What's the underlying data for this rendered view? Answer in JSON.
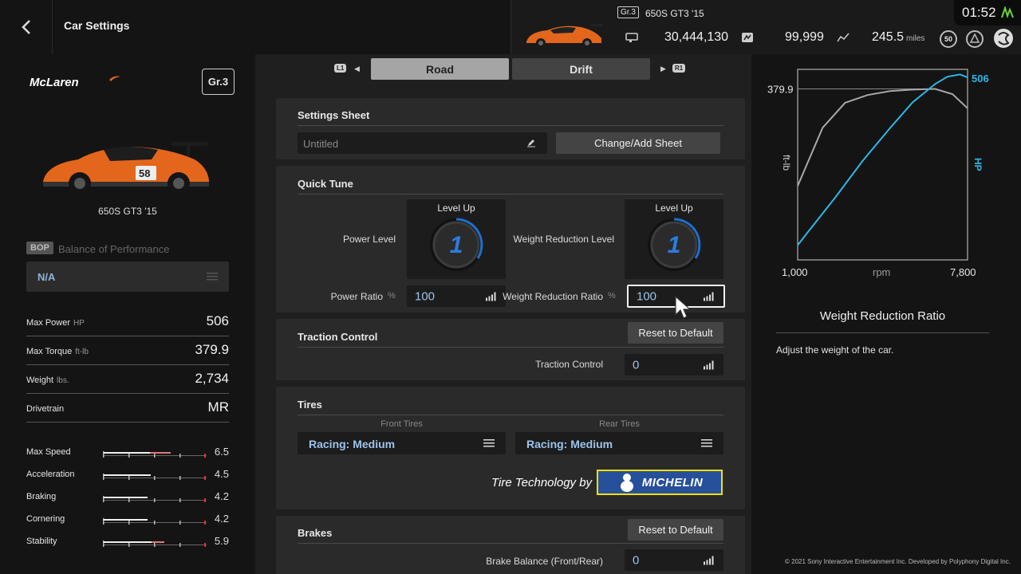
{
  "header": {
    "page_title": "Car Settings",
    "car_class": "Gr.3",
    "car_name": "650S GT3 '15",
    "credits": "30,444,130",
    "mileage_points": "99,999",
    "distance": "245.5",
    "distance_unit": "miles",
    "level": "50",
    "clock": "01:52"
  },
  "left": {
    "brand": "McLaren",
    "class_badge": "Gr.3",
    "car_name": "650S GT3 '15",
    "bop_badge": "BOP",
    "bop_label": "Balance of Performance",
    "bop_value": "N/A",
    "specs": [
      {
        "label": "Max Power",
        "unit": "HP",
        "value": "506"
      },
      {
        "label": "Max Torque",
        "unit": "ft-lb",
        "value": "379.9"
      },
      {
        "label": "Weight",
        "unit": "lbs.",
        "value": "2,734"
      },
      {
        "label": "Drivetrain",
        "unit": "",
        "value": "MR"
      }
    ],
    "performance": [
      {
        "label": "Max Speed",
        "value": "6.5",
        "fill": 0.65,
        "accent": 0.2
      },
      {
        "label": "Acceleration",
        "value": "4.5",
        "fill": 0.45,
        "accent": 0.0
      },
      {
        "label": "Braking",
        "value": "4.2",
        "fill": 0.42,
        "accent": 0.0
      },
      {
        "label": "Cornering",
        "value": "4.2",
        "fill": 0.42,
        "accent": 0.0
      },
      {
        "label": "Stability",
        "value": "5.9",
        "fill": 0.59,
        "accent": 0.12
      }
    ]
  },
  "tabs": {
    "left_button": "L1",
    "road": "Road",
    "drift": "Drift",
    "right_button": "R1"
  },
  "settings_sheet": {
    "title": "Settings Sheet",
    "sheet_name": "Untitled",
    "change_button": "Change/Add Sheet"
  },
  "quick_tune": {
    "title": "Quick Tune",
    "power_level_label": "Power Level",
    "power_level_title": "Level Up",
    "power_level_value": "1",
    "weight_level_label": "Weight Reduction Level",
    "weight_level_title": "Level Up",
    "weight_level_value": "1",
    "power_ratio_label": "Power Ratio",
    "power_ratio_unit": "%",
    "power_ratio_value": "100",
    "weight_ratio_label": "Weight Reduction Ratio",
    "weight_ratio_unit": "%",
    "weight_ratio_value": "100"
  },
  "traction": {
    "title": "Traction Control",
    "reset_button": "Reset to Default",
    "label": "Traction Control",
    "value": "0"
  },
  "tires": {
    "title": "Tires",
    "front_label": "Front Tires",
    "front_value": "Racing: Medium",
    "rear_label": "Rear Tires",
    "rear_value": "Racing: Medium",
    "tech_by": "Tire Technology by",
    "brand_logo": "MICHELIN"
  },
  "brakes": {
    "title": "Brakes",
    "reset_button": "Reset to Default",
    "balance_label": "Brake Balance (Front/Rear)",
    "balance_value": "0"
  },
  "chart_data": {
    "type": "line",
    "xlabel": "rpm",
    "x_ticks": [
      "1,000",
      "7,800"
    ],
    "xlim": [
      1000,
      7800
    ],
    "left_axis_label": "ft-lb",
    "right_axis_label": "HP",
    "torque_peak_label": "379.9",
    "power_peak_label": "506",
    "series": [
      {
        "name": "ft-lb",
        "color": "#a8a8a8",
        "x": [
          1000,
          2000,
          2900,
          3800,
          4700,
          5600,
          6500,
          7200,
          7800
        ],
        "y": [
          255,
          330,
          362,
          372,
          377,
          379,
          379.9,
          373,
          355
        ]
      },
      {
        "name": "HP",
        "color": "#2ab7e8",
        "x": [
          1000,
          1400,
          2500,
          3600,
          4700,
          5600,
          6500,
          7000,
          7500,
          7800
        ],
        "y": [
          40,
          75,
          170,
          270,
          360,
          430,
          480,
          500,
          506,
          498
        ]
      }
    ]
  },
  "info_panel": {
    "title": "Weight Reduction Ratio",
    "description": "Adjust the weight of the car."
  },
  "copyright": "© 2021 Sony Interactive Entertainment Inc. Developed by Polyphony Digital Inc."
}
